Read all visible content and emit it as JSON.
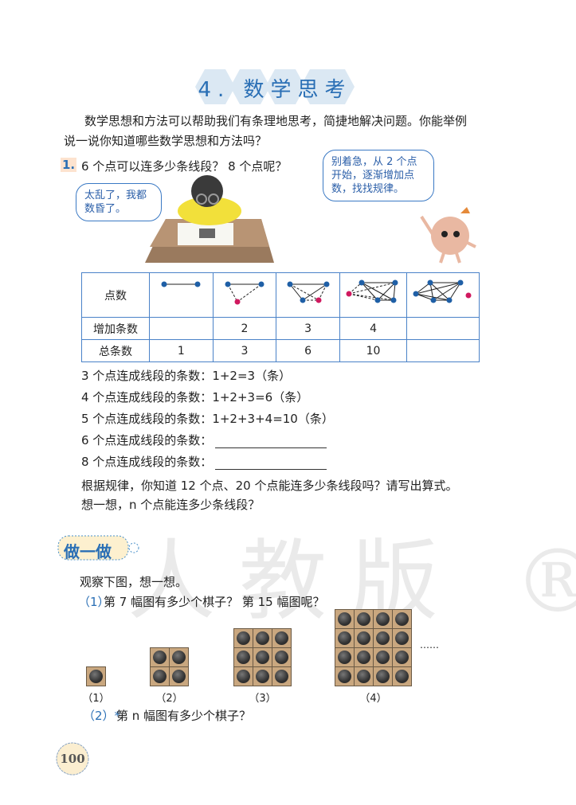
{
  "title": "4. 数学思考",
  "intro": {
    "line1": "数学思想和方法可以帮助我们有条理地思考，简捷地解决问题。你能举例",
    "line2": "说一说你知道哪些数学思想和方法吗？"
  },
  "q1": {
    "number": "1.",
    "text": "6 个点可以连多少条线段？ 8 个点呢？",
    "bubble_left": "太乱了，我都数昏了。",
    "bubble_right": "别着急，从 2 个点开始，逐渐增加点数，找找规律。"
  },
  "table": {
    "row_labels": [
      "点数",
      "增加条数",
      "总条数"
    ],
    "points": [
      2,
      3,
      4,
      5,
      6
    ],
    "added": [
      "",
      "2",
      "3",
      "4",
      ""
    ],
    "total": [
      "1",
      "3",
      "6",
      "10",
      ""
    ]
  },
  "lines": [
    "3 个点连成线段的条数：1+2=3（条）",
    "4 个点连成线段的条数：1+2+3=6（条）",
    "5 个点连成线段的条数：1+2+3+4=10（条）",
    "6 个点连成线段的条数：",
    "8 个点连成线段的条数："
  ],
  "rule": {
    "line1": "根据规律，你知道 12 个点、20 个点能连多少条线段吗？请写出算式。",
    "line2": "想一想，n 个点能连多少条线段？"
  },
  "activity": {
    "badge": "做一做",
    "intro": "观察下图，想一想。",
    "q1_num": "（1）",
    "q1": "第 7 幅图有多少个棋子？ 第 15 幅图呢？",
    "figures": [
      {
        "label": "（1）",
        "n": 1
      },
      {
        "label": "（2）",
        "n": 2
      },
      {
        "label": "（3）",
        "n": 3
      },
      {
        "label": "（4）",
        "n": 4
      }
    ],
    "ellipsis": "……",
    "q2_num": "（2）*",
    "q2": "第 n 幅图有多少个棋子？"
  },
  "watermark": "人教版 ®",
  "page_number": "100",
  "colors": {
    "accent": "#2a6fb5",
    "table_border": "#4a82c8",
    "dot": "#1f5fa6",
    "new_dot": "#d0195f",
    "board": "#c9a77f"
  }
}
